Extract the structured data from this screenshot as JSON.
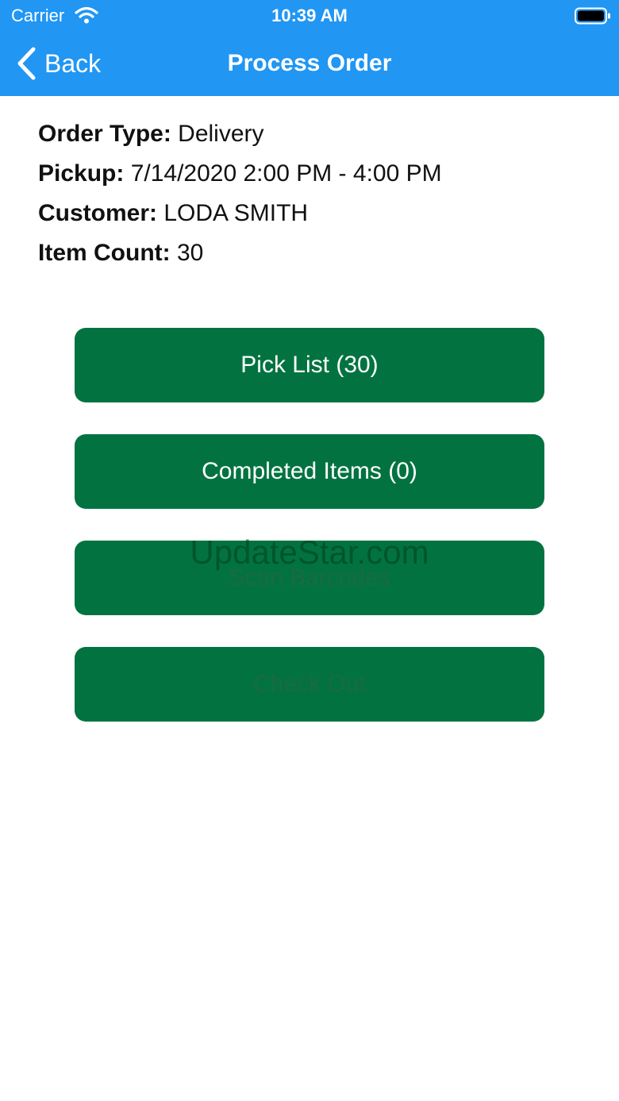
{
  "status_bar": {
    "carrier": "Carrier",
    "time": "10:39 AM",
    "wifi_icon": "wifi-icon",
    "battery_icon": "battery-icon"
  },
  "nav": {
    "back_label": "Back",
    "title": "Process Order",
    "back_icon": "chevron-left-icon"
  },
  "order": {
    "type_label": "Order Type:",
    "type_value": "Delivery",
    "pickup_label": "Pickup:",
    "pickup_value": "7/14/2020 2:00 PM - 4:00 PM",
    "customer_label": "Customer:",
    "customer_value": "LODA SMITH",
    "item_count_label": "Item Count:",
    "item_count_value": "30"
  },
  "actions": {
    "pick_list": "Pick List (30)",
    "completed_items": "Completed Items (0)",
    "scan_barcodes": "Scan Barcodes",
    "check_out": "Check Out"
  },
  "watermark": "UpdateStar.com",
  "colors": {
    "header": "#2196F3",
    "button": "#027340",
    "button_text": "#FFFFFF",
    "button_disabled_text": "#1B6A42"
  }
}
